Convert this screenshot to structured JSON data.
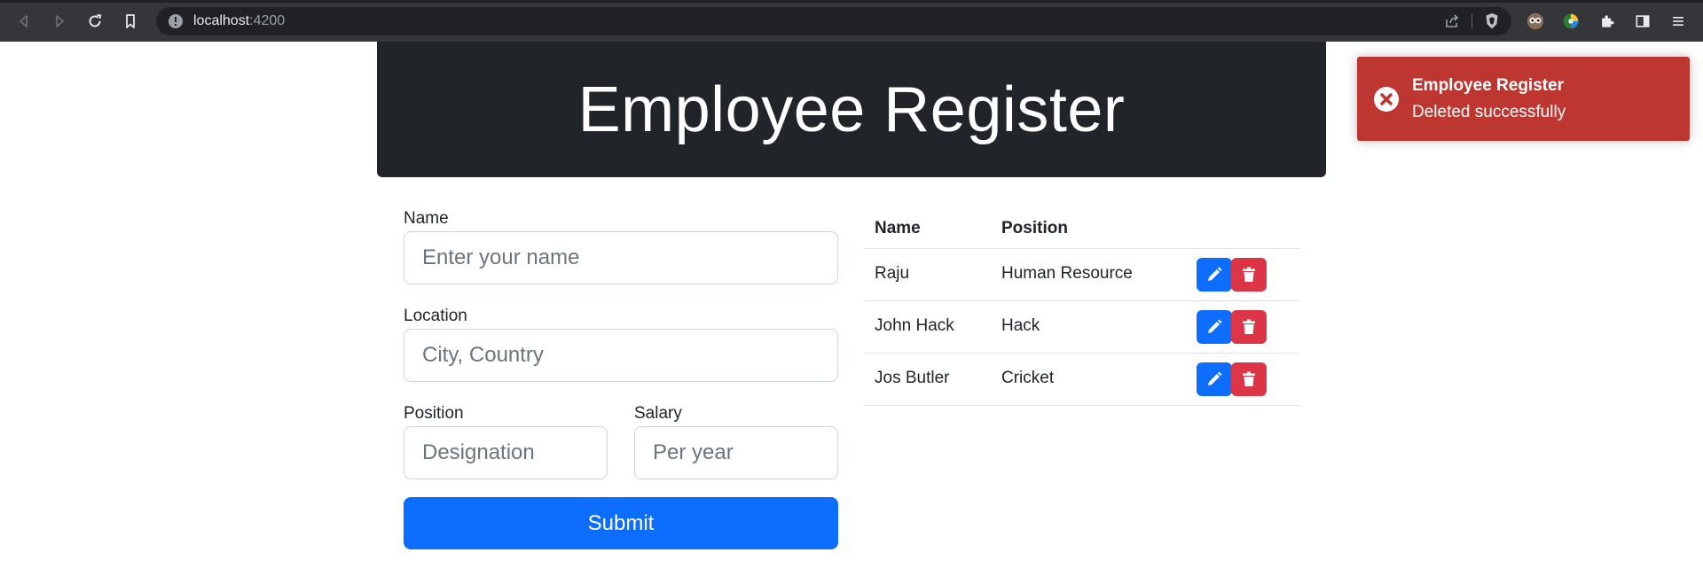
{
  "browser": {
    "url_host": "localhost",
    "url_port": ":4200"
  },
  "header": {
    "title": "Employee Register"
  },
  "form": {
    "name_label": "Name",
    "name_placeholder": "Enter your name",
    "location_label": "Location",
    "location_placeholder": "City, Country",
    "position_label": "Position",
    "position_placeholder": "Designation",
    "salary_label": "Salary",
    "salary_placeholder": "Per year",
    "submit_label": "Submit"
  },
  "table": {
    "headers": [
      "Name",
      "Position"
    ],
    "rows": [
      {
        "name": "Raju",
        "position": "Human Resource"
      },
      {
        "name": "John Hack",
        "position": "Hack"
      },
      {
        "name": "Jos Butler",
        "position": "Cricket"
      }
    ]
  },
  "toast": {
    "title": "Employee Register",
    "message": "Deleted successfully",
    "color": "#bd362f"
  },
  "colors": {
    "primary": "#0d6efd",
    "danger": "#dc3545",
    "header_bg": "#212529"
  },
  "icons": {
    "edit": "pencil-icon",
    "delete": "trash-icon",
    "toast": "error-circle-icon"
  }
}
